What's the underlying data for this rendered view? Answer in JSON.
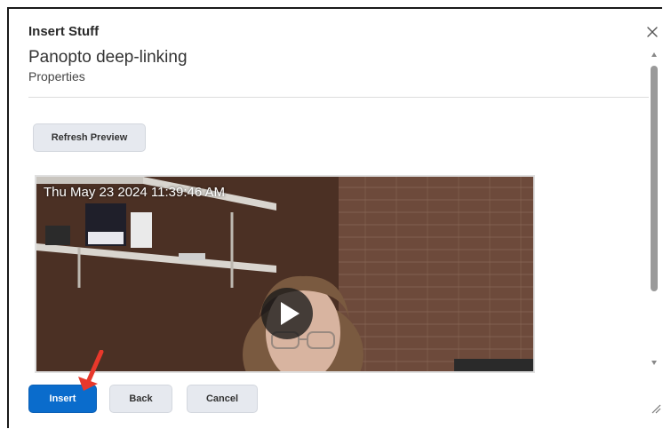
{
  "dialog": {
    "title": "Insert Stuff",
    "heading": "Panopto deep-linking",
    "subheading": "Properties"
  },
  "toolbar": {
    "refresh_label": "Refresh Preview"
  },
  "video": {
    "timestamp": "Thu May 23 2024 11:39:46 AM",
    "play_icon": "play-icon"
  },
  "footer": {
    "insert_label": "Insert",
    "back_label": "Back",
    "cancel_label": "Cancel"
  },
  "colors": {
    "primary": "#0a6ccc",
    "secondary_bg": "#e6e9ef",
    "annotation_arrow": "#e8382b"
  }
}
